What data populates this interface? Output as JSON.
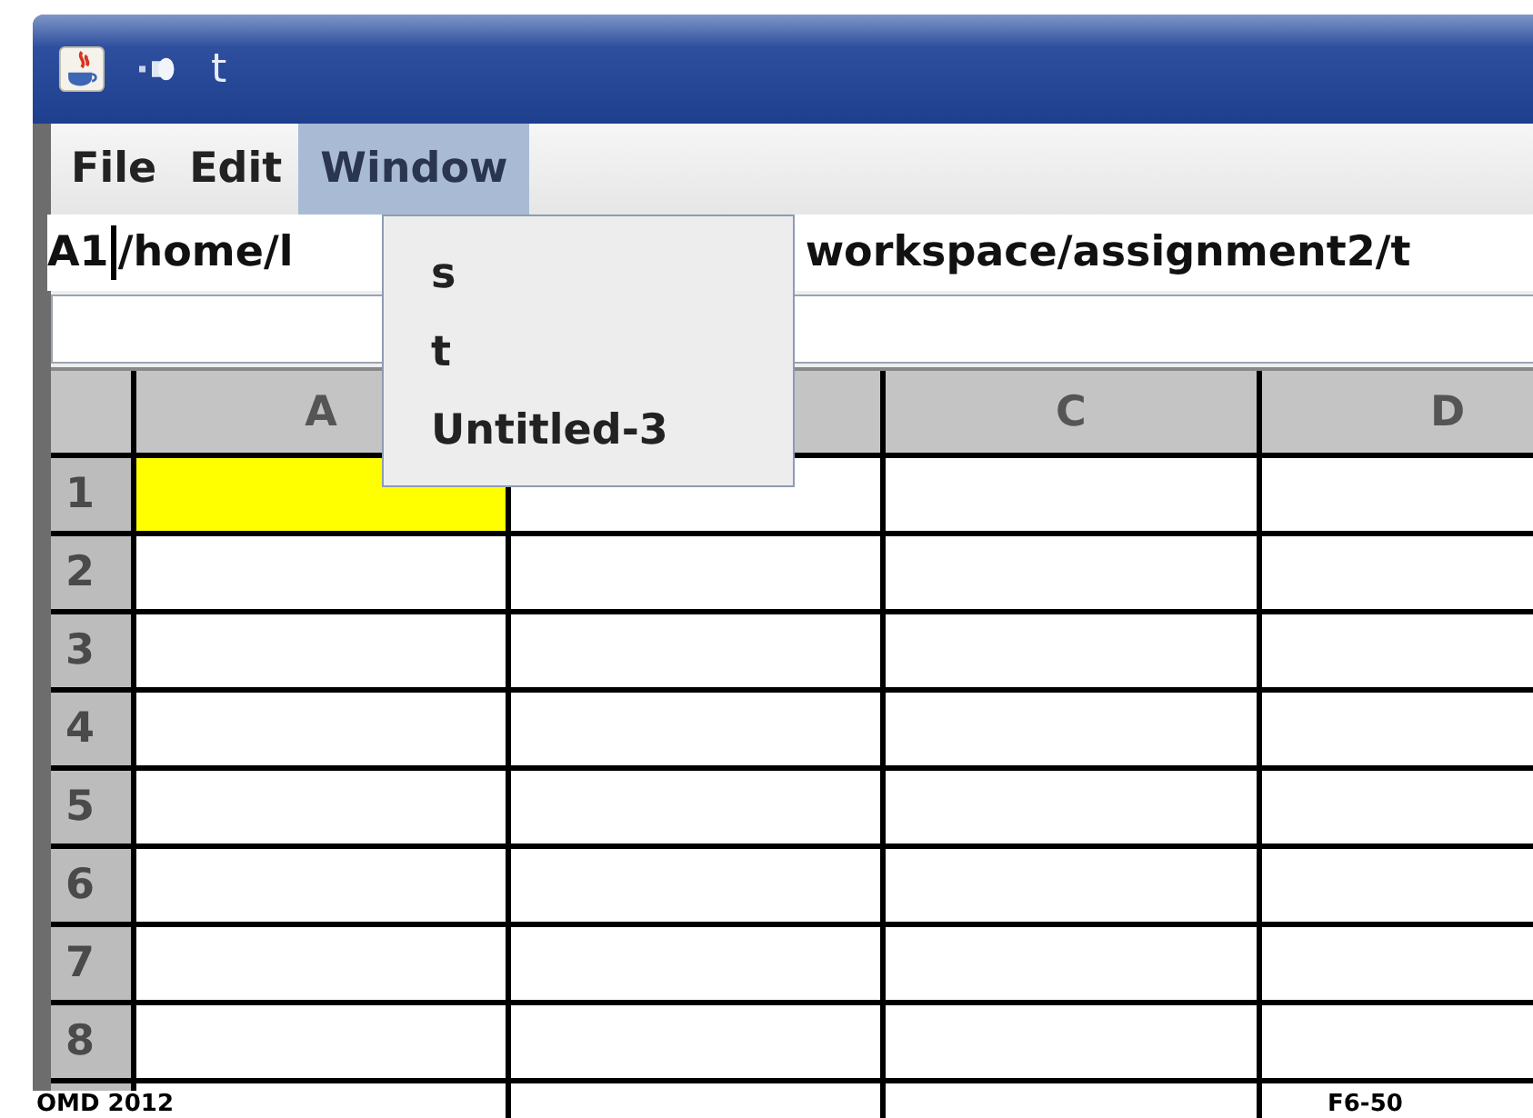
{
  "window": {
    "title": "t"
  },
  "menu_bar": [
    {
      "label": "File",
      "selected": false
    },
    {
      "label": "Edit",
      "selected": false
    },
    {
      "label": "Window",
      "selected": true
    }
  ],
  "open_menu": {
    "items": [
      {
        "label": "s"
      },
      {
        "label": "t"
      },
      {
        "label": "Untitled-3"
      }
    ]
  },
  "path_line": {
    "cell_ref": "A1",
    "path_parts": [
      "/home/l",
      "workspace/assignment2/t"
    ]
  },
  "grid": {
    "columns": [
      {
        "label": "A"
      },
      {},
      {
        "label": "C"
      },
      {
        "label": "D"
      }
    ],
    "rows": [
      {
        "label": "1",
        "cells": [
          {
            "selected": true
          },
          {
            "selected": false
          },
          {
            "selected": false
          },
          {
            "selected": false
          }
        ]
      },
      {
        "label": "2",
        "cells": [
          {
            "selected": false
          },
          {
            "selected": false
          },
          {
            "selected": false
          },
          {
            "selected": false
          }
        ]
      },
      {
        "label": "3",
        "cells": [
          {
            "selected": false
          },
          {
            "selected": false
          },
          {
            "selected": false
          },
          {
            "selected": false
          }
        ]
      },
      {
        "label": "4",
        "cells": [
          {
            "selected": false
          },
          {
            "selected": false
          },
          {
            "selected": false
          },
          {
            "selected": false
          }
        ]
      },
      {
        "label": "5",
        "cells": [
          {
            "selected": false
          },
          {
            "selected": false
          },
          {
            "selected": false
          },
          {
            "selected": false
          }
        ]
      },
      {
        "label": "6",
        "cells": [
          {
            "selected": false
          },
          {
            "selected": false
          },
          {
            "selected": false
          },
          {
            "selected": false
          }
        ]
      },
      {
        "label": "7",
        "cells": [
          {
            "selected": false
          },
          {
            "selected": false
          },
          {
            "selected": false
          },
          {
            "selected": false
          }
        ]
      },
      {
        "label": "8",
        "cells": [
          {
            "selected": false
          },
          {
            "selected": false
          },
          {
            "selected": false
          },
          {
            "selected": false
          }
        ]
      }
    ]
  },
  "footer": {
    "left": "OMD 2012",
    "right": "F6-50"
  }
}
